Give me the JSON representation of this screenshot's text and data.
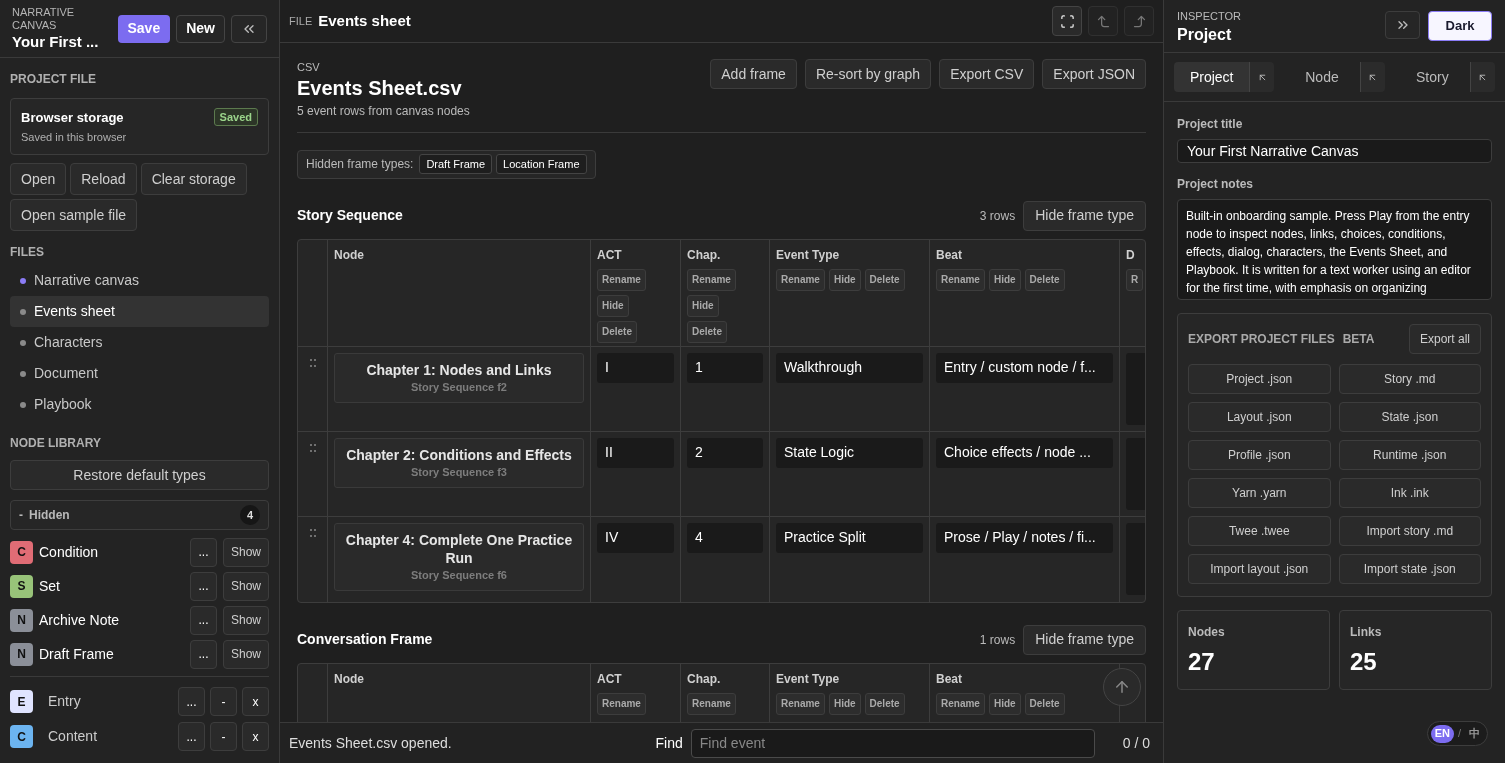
{
  "sidebar": {
    "app_label": "NARRATIVE CANVAS",
    "project_name": "Your First ...",
    "buttons": [
      {
        "label": "Save",
        "kind": "primary"
      },
      {
        "label": "New",
        "kind": "plain"
      }
    ],
    "project_file": {
      "heading": "PROJECT FILE",
      "storage": {
        "title": "Browser storage",
        "subtitle": "Saved in this browser",
        "badge": "Saved"
      },
      "buttons": [
        "Open",
        "Reload",
        "Clear storage",
        "Open sample file"
      ]
    },
    "files": {
      "heading": "FILES",
      "items": [
        {
          "label": "Narrative canvas",
          "color": "#8b7cf6",
          "selected": false
        },
        {
          "label": "Events sheet",
          "color": "#8a8a8a",
          "selected": true
        },
        {
          "label": "Characters",
          "color": "#8a8a8a",
          "selected": false
        },
        {
          "label": "Document",
          "color": "#8a8a8a",
          "selected": false
        },
        {
          "label": "Playbook",
          "color": "#8a8a8a",
          "selected": false
        }
      ]
    },
    "node_library": {
      "heading": "NODE LIBRARY",
      "restore_button": "Restore default types",
      "hidden_group": {
        "toggle": "-",
        "label": "Hidden",
        "count": "4",
        "items": [
          {
            "letter": "C",
            "name": "Condition",
            "color": "#e06c75",
            "menu": "...",
            "action": "Show"
          },
          {
            "letter": "S",
            "name": "Set",
            "color": "#98c379",
            "menu": "...",
            "action": "Show"
          },
          {
            "letter": "N",
            "name": "Archive Note",
            "color": "#8b8f98",
            "menu": "...",
            "action": "Show"
          },
          {
            "letter": "N",
            "name": "Draft Frame",
            "color": "#8b8f98",
            "menu": "...",
            "action": "Show"
          }
        ]
      },
      "types": [
        {
          "letter": "E",
          "name": "Entry",
          "color": "#e0e4ff",
          "menu": "...",
          "collapse": "-",
          "remove": "x"
        },
        {
          "letter": "C",
          "name": "Content",
          "color": "#6cb4f0",
          "menu": "...",
          "collapse": "-",
          "remove": "x"
        }
      ]
    }
  },
  "editor": {
    "file_label": "FILE",
    "title": "Events sheet",
    "toolbar": [
      {
        "kind": "fullscreen",
        "disabled": false
      },
      {
        "kind": "undo",
        "disabled": true
      },
      {
        "kind": "redo",
        "disabled": true
      }
    ],
    "sheet": {
      "type_label": "CSV",
      "title": "Events Sheet.csv",
      "subtitle": "5 event rows from canvas nodes",
      "actions": [
        "Add frame",
        "Re-sort by graph",
        "Export CSV",
        "Export JSON"
      ],
      "hidden_frames": {
        "label": "Hidden frame types:",
        "tags": [
          "Draft Frame",
          "Location Frame"
        ]
      },
      "groups": [
        {
          "title": "Story Sequence",
          "count": "3 rows",
          "button": "Hide frame type",
          "columns": [
            {
              "label": "Node"
            },
            {
              "label": "ACT",
              "buttons": [
                "Rename",
                "Hide",
                "Delete"
              ]
            },
            {
              "label": "Chap.",
              "buttons": [
                "Rename",
                "Hide",
                "Delete"
              ]
            },
            {
              "label": "Event Type",
              "buttons": [
                "Rename",
                "Hide",
                "Delete"
              ]
            },
            {
              "label": "Beat",
              "buttons": [
                "Rename",
                "Hide",
                "Delete"
              ]
            },
            {
              "label": "D",
              "buttons": [
                "R"
              ]
            }
          ],
          "rows": [
            {
              "node": "Chapter 1: Nodes and Links",
              "frame": "Story Sequence f2",
              "act": "I",
              "chap": "1",
              "event_type": "Walkthrough",
              "beat": "Entry / custom node / f..."
            },
            {
              "node": "Chapter 2: Conditions and Effects",
              "frame": "Story Sequence f3",
              "act": "II",
              "chap": "2",
              "event_type": "State Logic",
              "beat": "Choice effects / node ..."
            },
            {
              "node": "Chapter 4: Complete One Practice Run",
              "frame": "Story Sequence f6",
              "act": "IV",
              "chap": "4",
              "event_type": "Practice Split",
              "beat": "Prose / Play / notes / fi..."
            }
          ]
        },
        {
          "title": "Conversation Frame",
          "count": "1 rows",
          "button": "Hide frame type",
          "columns": [
            {
              "label": "Node"
            },
            {
              "label": "ACT",
              "buttons": [
                "Rename"
              ]
            },
            {
              "label": "Chap.",
              "buttons": [
                "Rename"
              ]
            },
            {
              "label": "Event Type",
              "buttons": [
                "Rename",
                "Hide",
                "Delete"
              ]
            },
            {
              "label": "Beat",
              "buttons": [
                "Rename",
                "Hide",
                "Delete"
              ]
            }
          ]
        }
      ]
    },
    "status": "Events Sheet.csv opened.",
    "find": {
      "label": "Find",
      "placeholder": "Find event",
      "count": "0 / 0"
    }
  },
  "inspector": {
    "label": "INSPECTOR",
    "title": "Project",
    "theme_button": "Dark",
    "tabs": [
      {
        "label": "Project",
        "selected": true
      },
      {
        "label": "Node",
        "selected": false
      },
      {
        "label": "Story",
        "selected": false
      }
    ],
    "fields": {
      "title_label": "Project title",
      "title_value": "Your First Narrative Canvas",
      "notes_label": "Project notes",
      "notes_value": "Built-in onboarding sample. Press Play from the entry node to inspect nodes, links, choices, conditions, effects, dialog, characters, the Events Sheet, and Playbook. It is written for a text worker using an editor for the first time, with emphasis on organizing"
    },
    "export": {
      "title": "EXPORT PROJECT FILES",
      "badge": "BETA",
      "all_button": "Export all",
      "buttons": [
        "Project .json",
        "Story .md",
        "Layout .json",
        "State .json",
        "Profile .json",
        "Runtime .json",
        "Yarn .yarn",
        "Ink .ink",
        "Twee .twee",
        "Import story .md",
        "Import layout .json",
        "Import state .json"
      ]
    },
    "stats": [
      {
        "label": "Nodes",
        "value": "27"
      },
      {
        "label": "Links",
        "value": "25"
      }
    ],
    "languages": [
      {
        "label": "EN",
        "selected": true
      },
      {
        "label": "中",
        "selected": false
      }
    ],
    "language_separator": "/"
  }
}
